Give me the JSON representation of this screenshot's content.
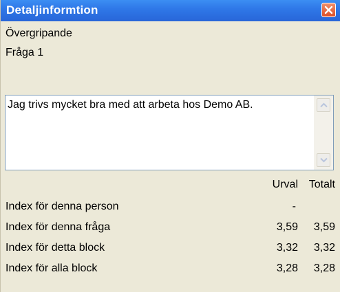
{
  "window": {
    "title": "Detaljinformtion"
  },
  "header": {
    "category": "Övergripande",
    "question": "Fråga 1"
  },
  "text": {
    "content": "Jag trivs mycket bra med att arbeta hos Demo AB."
  },
  "table": {
    "columns": [
      "Urval",
      "Totalt"
    ],
    "rows": [
      {
        "label": "Index för denna person",
        "urval": "-",
        "totalt": ""
      },
      {
        "label": "Index för denna fråga",
        "urval": "3,59",
        "totalt": "3,59"
      },
      {
        "label": "Index för detta block",
        "urval": "3,32",
        "totalt": "3,32"
      },
      {
        "label": "Index för alla block",
        "urval": "3,28",
        "totalt": "3,28"
      }
    ]
  },
  "icons": {
    "close": "close-icon",
    "scroll_up": "chevron-up-icon",
    "scroll_down": "chevron-down-icon"
  },
  "colors": {
    "titlebar": "#2f78e8",
    "close_button": "#dd4f27",
    "window_bg": "#ece9d8"
  }
}
